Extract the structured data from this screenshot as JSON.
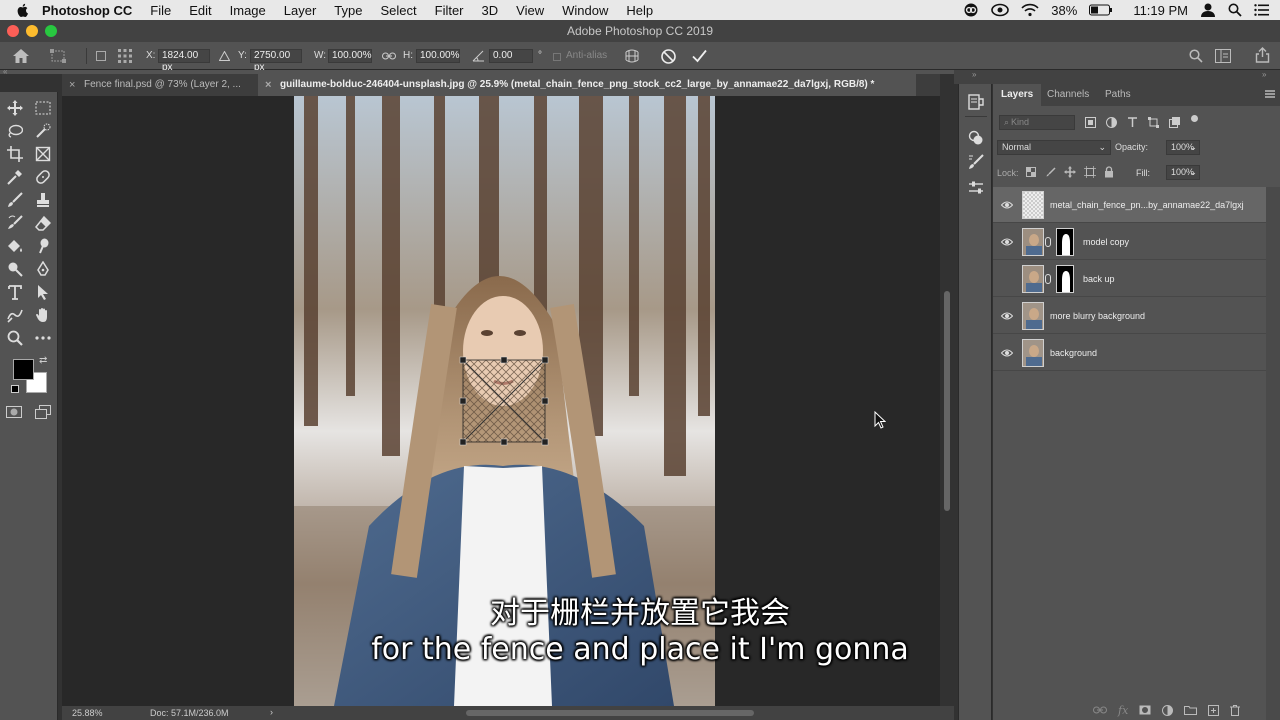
{
  "menubar": {
    "app_name": "Photoshop CC",
    "items": [
      "File",
      "Edit",
      "Image",
      "Layer",
      "Type",
      "Select",
      "Filter",
      "3D",
      "View",
      "Window",
      "Help"
    ],
    "battery": "38%",
    "time": "11:19 PM"
  },
  "window": {
    "title": "Adobe Photoshop CC 2019"
  },
  "options_bar": {
    "x_label": "X:",
    "x_value": "1824.00 px",
    "y_label": "Y:",
    "y_value": "2750.00 px",
    "w_label": "W:",
    "w_value": "100.00%",
    "h_label": "H:",
    "h_value": "100.00%",
    "angle_value": "0.00",
    "angle_unit": "°",
    "antialias": "Anti-alias"
  },
  "tabs": [
    {
      "label": "Fence final.psd @ 73% (Layer 2, ...",
      "active": false
    },
    {
      "label": "guillaume-bolduc-246404-unsplash.jpg @ 25.9% (metal_chain_fence_png_stock_cc2_large_by_annamae22_da7lgxj, RGB/8) *",
      "active": true
    }
  ],
  "status": {
    "zoom": "25.88%",
    "doc": "Doc: 57.1M/236.0M",
    "arrow": "›"
  },
  "layers_panel": {
    "tabs": [
      "Layers",
      "Channels",
      "Paths"
    ],
    "kind_placeholder": "Kind",
    "blend_mode": "Normal",
    "opacity_label": "Opacity:",
    "opacity_value": "100%",
    "lock_label": "Lock:",
    "fill_label": "Fill:",
    "fill_value": "100%",
    "layers": [
      {
        "name": "metal_chain_fence_pn...by_annamae22_da7lgxj",
        "visible": true,
        "selected": true,
        "has_mask": false
      },
      {
        "name": "model copy",
        "visible": true,
        "selected": false,
        "has_mask": true
      },
      {
        "name": "back up",
        "visible": false,
        "selected": false,
        "has_mask": true
      },
      {
        "name": "more blurry background",
        "visible": true,
        "selected": false,
        "has_mask": false
      },
      {
        "name": "background",
        "visible": true,
        "selected": false,
        "has_mask": false
      }
    ]
  },
  "subtitles": {
    "zh": "对于栅栏并放置它我会",
    "en": "for the fence and place it I'm gonna"
  },
  "colors": {
    "panel_bg": "#535353",
    "canvas_bg": "#282828",
    "selected_layer": "#666666"
  }
}
